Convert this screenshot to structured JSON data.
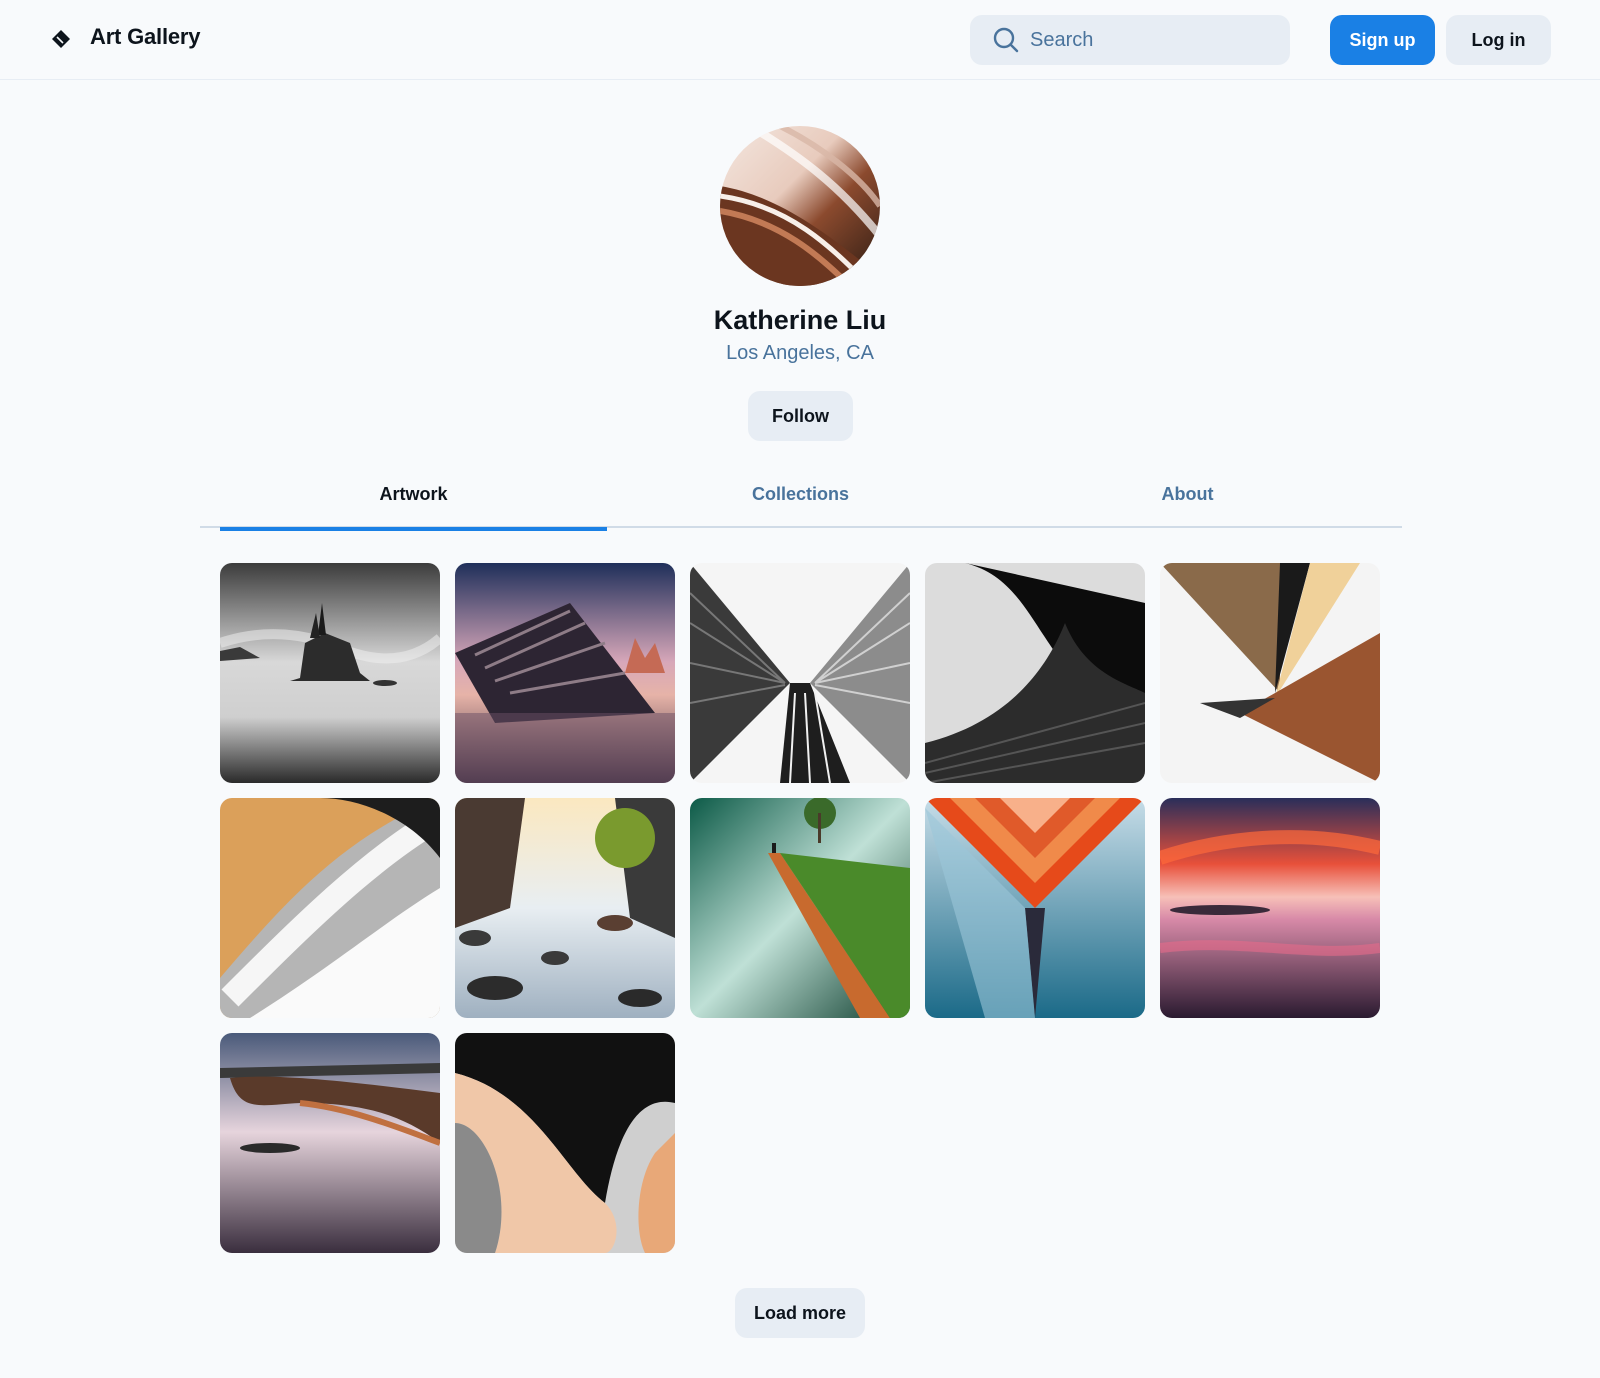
{
  "header": {
    "brand": "Art Gallery",
    "logo_icon": "diamond-tag-icon",
    "search_placeholder": "Search",
    "search_icon": "search-icon",
    "signup_label": "Sign up",
    "login_label": "Log in"
  },
  "profile": {
    "name": "Katherine Liu",
    "location": "Los Angeles, CA",
    "follow_label": "Follow"
  },
  "tabs": [
    {
      "label": "Artwork",
      "active": true
    },
    {
      "label": "Collections",
      "active": false
    },
    {
      "label": "About",
      "active": false
    }
  ],
  "artworks_count_shown": 12,
  "load_more_label": "Load more",
  "colors": {
    "background": "#f8fafc",
    "primary": "#1a80e5",
    "secondary_button": "#e7edf4",
    "muted_text": "#49739c",
    "text": "#0d141c"
  }
}
